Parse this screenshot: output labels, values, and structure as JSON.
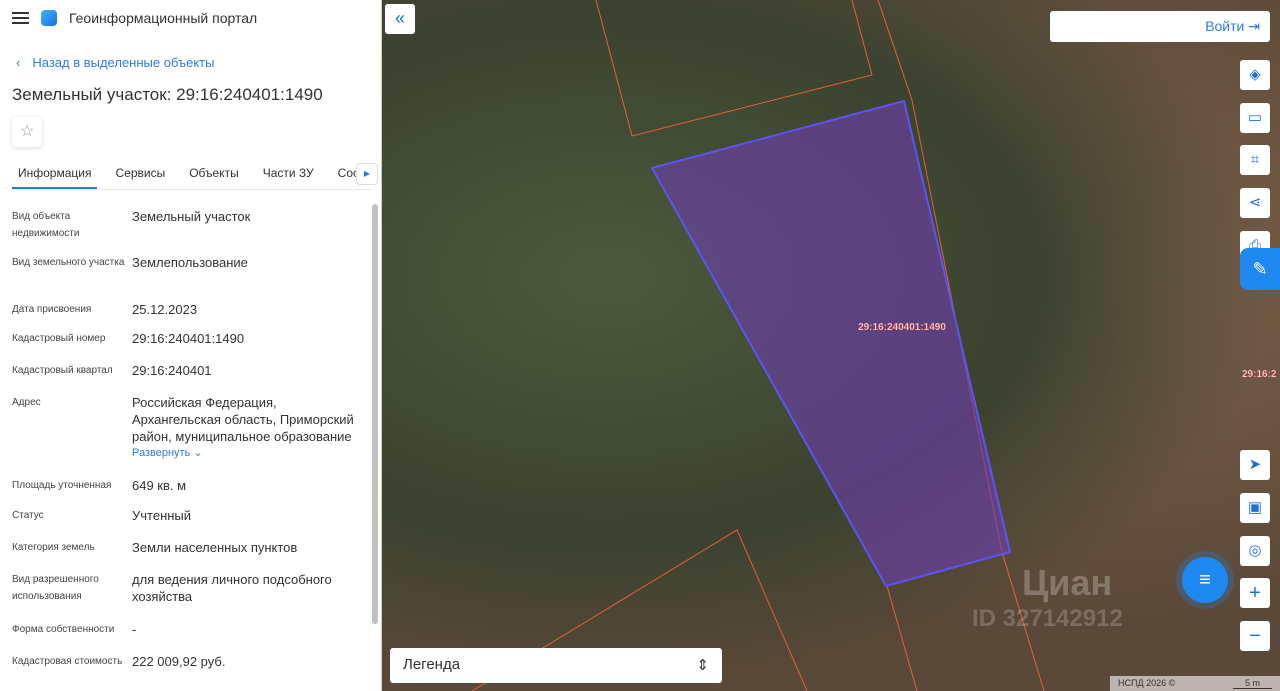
{
  "header": {
    "title": "Геоинформационный портал"
  },
  "back_link": "Назад в выделенные объекты",
  "object_title": "Земельный участок: 29:16:240401:1490",
  "tabs": [
    "Информация",
    "Сервисы",
    "Объекты",
    "Части ЗУ",
    "Состав"
  ],
  "info": [
    {
      "label": "Вид объекта недвижимости",
      "value": "Земельный участок"
    },
    {
      "label": "Вид земельного участка",
      "value": "Землепользование"
    },
    {
      "label": "Дата присвоения",
      "value": "25.12.2023"
    },
    {
      "label": "Кадастровый номер",
      "value": "29:16:240401:1490"
    },
    {
      "label": "Кадастровый квартал",
      "value": "29:16:240401"
    },
    {
      "label": "Адрес",
      "value": "Российская Федерация, Архангельская область, Приморский район, муниципальное образование"
    },
    {
      "label": "Площадь уточненная",
      "value": "649 кв. м"
    },
    {
      "label": "Статус",
      "value": "Учтенный"
    },
    {
      "label": "Категория земель",
      "value": "Земли населенных пунктов"
    },
    {
      "label": "Вид разрешенного использования",
      "value": "для ведения личного подсобного хозяйства"
    },
    {
      "label": "Форма собственности",
      "value": "-"
    },
    {
      "label": "Кадастровая стоимость",
      "value": "222 009,92 руб."
    }
  ],
  "expand_label": "Развернуть",
  "map": {
    "login": "Войти",
    "legend": "Легенда",
    "parcel_label": "29:16:240401:1490",
    "edge_label": "29:16:2",
    "copyright": "НСПД 2026 ©",
    "scale": "5 m",
    "watermark": "Циан",
    "watermark_id": "ID 327142912"
  },
  "colors": {
    "accent": "#2f7ce0",
    "parcel_fill": "#6a3fa8",
    "parcel_stroke": "#5a55f0",
    "boundary": "#e0603a"
  }
}
